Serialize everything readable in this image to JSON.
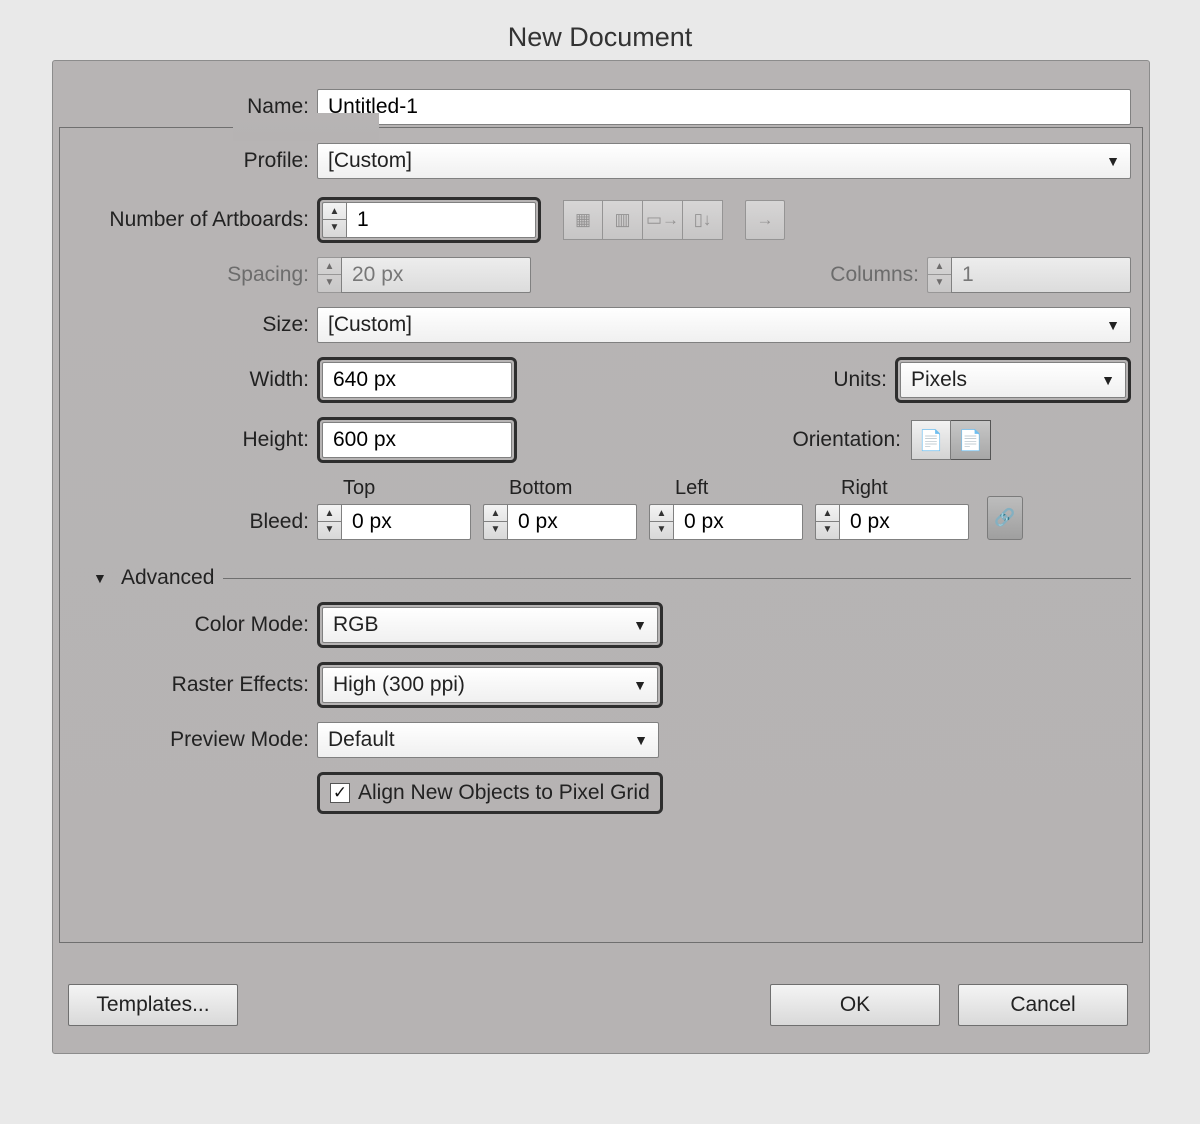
{
  "title": "New Document",
  "labels": {
    "name": "Name:",
    "profile": "Profile:",
    "artboards": "Number of Artboards:",
    "spacing": "Spacing:",
    "columns": "Columns:",
    "size": "Size:",
    "width": "Width:",
    "height": "Height:",
    "units": "Units:",
    "orientation": "Orientation:",
    "bleed": "Bleed:",
    "advanced": "Advanced",
    "color_mode": "Color Mode:",
    "raster": "Raster Effects:",
    "preview": "Preview Mode:",
    "align": "Align New Objects to Pixel Grid"
  },
  "values": {
    "name": "Untitled-1",
    "profile": "[Custom]",
    "artboards": "1",
    "spacing": "20 px",
    "columns": "1",
    "size": "[Custom]",
    "width": "640 px",
    "height": "600 px",
    "units": "Pixels",
    "bleed_top": "0 px",
    "bleed_bottom": "0 px",
    "bleed_left": "0 px",
    "bleed_right": "0 px",
    "color_mode": "RGB",
    "raster": "High (300 ppi)",
    "preview": "Default"
  },
  "bleed_labels": {
    "top": "Top",
    "bottom": "Bottom",
    "left": "Left",
    "right": "Right"
  },
  "buttons": {
    "templates": "Templates...",
    "ok": "OK",
    "cancel": "Cancel"
  },
  "checkmark": "✓"
}
